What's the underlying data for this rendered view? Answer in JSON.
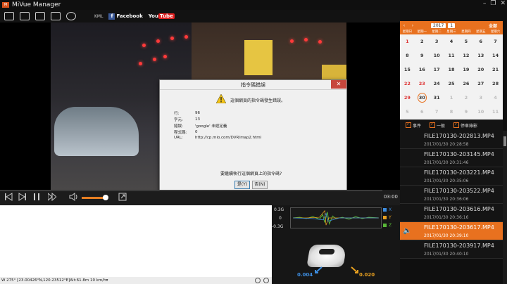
{
  "app": {
    "title": "MiVue Manager"
  },
  "toolbar": {
    "kml": "KML",
    "facebook": "Facebook",
    "youtube_a": "You",
    "youtube_b": "Tube"
  },
  "dialog": {
    "title": "指令碼錯誤",
    "message": "這個網頁的指令碼發生錯誤。",
    "rows": [
      {
        "label": "行:",
        "value": "96"
      },
      {
        "label": "字元:",
        "value": "13"
      },
      {
        "label": "錯誤:",
        "value": "'google' 未經定義"
      },
      {
        "label": "程式碼:",
        "value": "0"
      },
      {
        "label": "URL:",
        "value": "http://cp.mio.com/DVR/map2.html"
      }
    ],
    "question": "要繼續執行這個網頁上的指令碼?",
    "yes": "是(Y)",
    "no": "否(N)"
  },
  "player": {
    "duration": "03:00",
    "volume_level": 0.75
  },
  "status": {
    "text": "W 275° [23.00426°N,120.23512°E]Alt:61.8m    10   km/h▾"
  },
  "gsensor": {
    "scale_top": "0.3G",
    "scale_mid": "0",
    "scale_bot": "-0.3G",
    "legend": [
      {
        "label": "X",
        "color": "#3d8de0"
      },
      {
        "label": "Y",
        "color": "#e8a020"
      },
      {
        "label": "Z",
        "color": "#58b838"
      }
    ],
    "value_left": "0.004",
    "value_right": "0.020"
  },
  "calendar": {
    "prev": "‹",
    "next": "›",
    "year": "2017",
    "month": "1",
    "all": "全部",
    "dow": [
      "星期日",
      "星期一",
      "星期二",
      "星期三",
      "星期四",
      "星期五",
      "星期六"
    ],
    "days": [
      {
        "d": "1",
        "c": "red"
      },
      {
        "d": "2"
      },
      {
        "d": "3"
      },
      {
        "d": "4"
      },
      {
        "d": "5"
      },
      {
        "d": "6"
      },
      {
        "d": "7"
      },
      {
        "d": "8"
      },
      {
        "d": "9"
      },
      {
        "d": "10"
      },
      {
        "d": "11"
      },
      {
        "d": "12"
      },
      {
        "d": "13"
      },
      {
        "d": "14"
      },
      {
        "d": "15"
      },
      {
        "d": "16"
      },
      {
        "d": "17"
      },
      {
        "d": "18"
      },
      {
        "d": "19"
      },
      {
        "d": "20"
      },
      {
        "d": "21"
      },
      {
        "d": "22",
        "c": "red"
      },
      {
        "d": "23",
        "c": "red"
      },
      {
        "d": "24"
      },
      {
        "d": "25"
      },
      {
        "d": "26"
      },
      {
        "d": "27"
      },
      {
        "d": "28"
      },
      {
        "d": "29",
        "c": "red"
      },
      {
        "d": "30",
        "c": "today"
      },
      {
        "d": "31"
      },
      {
        "d": "1",
        "c": "dim"
      },
      {
        "d": "2",
        "c": "dim"
      },
      {
        "d": "3",
        "c": "dim"
      },
      {
        "d": "4",
        "c": "dim"
      },
      {
        "d": "5",
        "c": "dim"
      },
      {
        "d": "6",
        "c": "dim"
      },
      {
        "d": "7",
        "c": "dim"
      },
      {
        "d": "8",
        "c": "dim"
      },
      {
        "d": "9",
        "c": "dim"
      },
      {
        "d": "10",
        "c": "dim"
      },
      {
        "d": "11",
        "c": "dim"
      }
    ]
  },
  "filters": {
    "event": "事件",
    "normal": "一般",
    "parking": "停車錄影"
  },
  "files": [
    {
      "name": "FILE170130-202813.MP4",
      "date": "2017/01/30    20:28:58"
    },
    {
      "name": "FILE170130-203145.MP4",
      "date": "2017/01/30    20:31:46"
    },
    {
      "name": "FILE170130-203221.MP4",
      "date": "2017/01/30    20:35:06"
    },
    {
      "name": "FILE170130-203522.MP4",
      "date": "2017/01/30    20:36:06"
    },
    {
      "name": "FILE170130-203616.MP4",
      "date": "2017/01/30    20:36:16"
    },
    {
      "name": "FILE170130-203617.MP4",
      "date": "2017/01/30    20:39:10",
      "active": true
    },
    {
      "name": "FILE170130-203917.MP4",
      "date": "2017/01/30    20:40:10"
    }
  ]
}
